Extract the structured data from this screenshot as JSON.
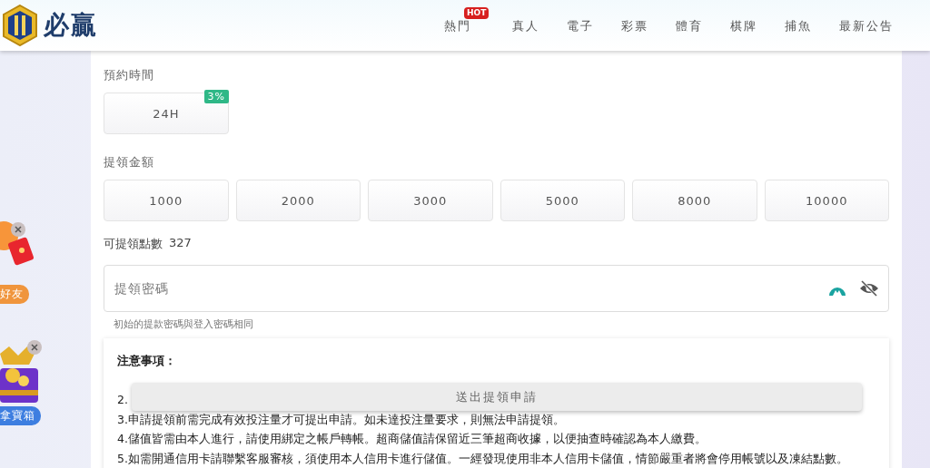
{
  "header": {
    "logo_text": "必贏",
    "nav": [
      {
        "label": "熱門",
        "badge": "HOT"
      },
      {
        "label": "真人"
      },
      {
        "label": "電子"
      },
      {
        "label": "彩票"
      },
      {
        "label": "體育"
      },
      {
        "label": "棋牌"
      },
      {
        "label": "捕魚"
      },
      {
        "label": "最新公告"
      }
    ]
  },
  "floating_promos": [
    {
      "kind": "gift",
      "label": "好友"
    },
    {
      "kind": "chest",
      "label": "拿寶箱"
    }
  ],
  "reservation": {
    "label": "預約時間",
    "options": [
      {
        "label": "24H",
        "badge": "3%"
      }
    ]
  },
  "amount": {
    "label": "提領金額",
    "options": [
      "1000",
      "2000",
      "3000",
      "5000",
      "8000",
      "10000"
    ]
  },
  "balance": {
    "label": "可提領點數",
    "value": "327"
  },
  "password": {
    "placeholder": "提領密碼",
    "hint": "初始的提款密碼與登入密碼相同"
  },
  "notice": {
    "title": "注意事項：",
    "lines": [
      "2.",
      "3.申請提領前需完成有效投注量才可提出申請。如未達投注量要求，則無法申請提領。",
      "4.儲值皆需由本人進行，請使用綁定之帳戶轉帳。超商儲值請保留近三筆超商收據，以便抽查時確認為本人繳費。",
      "5.如需開通信用卡請聯繫客服審核，須使用本人信用卡進行儲值。一經發現使用非本人信用卡儲值，情節嚴重者將會停用帳號以及凍結點數。"
    ]
  },
  "submit_button": "送出提領申請"
}
